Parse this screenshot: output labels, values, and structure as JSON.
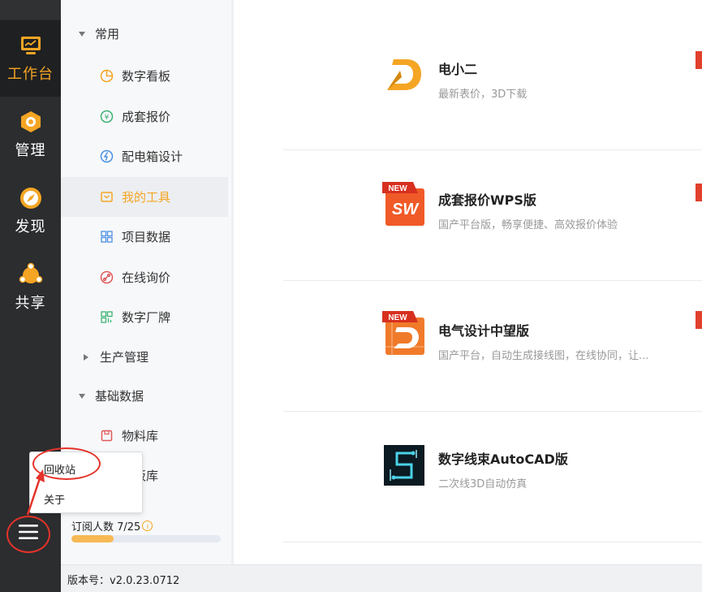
{
  "rail": {
    "items": [
      {
        "label": "工作台",
        "icon": "monitor-icon",
        "active": true
      },
      {
        "label": "管理",
        "icon": "hexagon-gear-icon",
        "active": false
      },
      {
        "label": "发现",
        "icon": "compass-icon",
        "active": false
      },
      {
        "label": "共享",
        "icon": "share-nodes-icon",
        "active": false
      }
    ],
    "menu_icon": "hamburger-icon"
  },
  "sidebar": {
    "groups": [
      {
        "label": "常用",
        "expanded": true,
        "items": [
          {
            "label": "数字看板",
            "icon": "pie-chart-icon"
          },
          {
            "label": "成套报价",
            "icon": "yen-icon"
          },
          {
            "label": "配电箱设计",
            "icon": "lightning-icon"
          },
          {
            "label": "我的工具",
            "icon": "toolbox-icon",
            "active": true
          },
          {
            "label": "项目数据",
            "icon": "grid-icon"
          },
          {
            "label": "在线询价",
            "icon": "link-icon"
          },
          {
            "label": "数字厂牌",
            "icon": "factory-icon"
          }
        ]
      },
      {
        "label": "生产管理",
        "expanded": false,
        "items": []
      },
      {
        "label": "基础数据",
        "expanded": true,
        "items": [
          {
            "label": "物料库",
            "icon": "box-icon"
          },
          {
            "label": "模板库",
            "icon": "template-icon"
          }
        ]
      }
    ],
    "subscription": {
      "label": "订阅人数 7/25",
      "current": 7,
      "total": 25,
      "info_icon": "i"
    }
  },
  "tools": [
    {
      "title": "电小二",
      "desc": "最新表价，3D下载",
      "logo": "dianxiaoer-logo",
      "new": false
    },
    {
      "title": "成套报价WPS版",
      "desc": "国产平台版，畅享便捷、高效报价体验",
      "logo": "sw-logo",
      "new": true,
      "badge": "NEW"
    },
    {
      "title": "电气设计中望版",
      "desc": "国产平台，自动生成接线图，在线协同，让...",
      "logo": "zwcad-logo",
      "new": true,
      "badge": "NEW"
    },
    {
      "title": "数字线束AutoCAD版",
      "desc": "二次线3D自动仿真",
      "logo": "harness-logo",
      "new": false
    }
  ],
  "footer": {
    "version": "版本号：v2.0.23.0712"
  },
  "popup": {
    "items": [
      {
        "label": "回收站"
      },
      {
        "label": "关于"
      }
    ]
  },
  "colors": {
    "accent": "#f5a524",
    "rail": "#2b2d2f",
    "annotation": "#e5332a"
  }
}
